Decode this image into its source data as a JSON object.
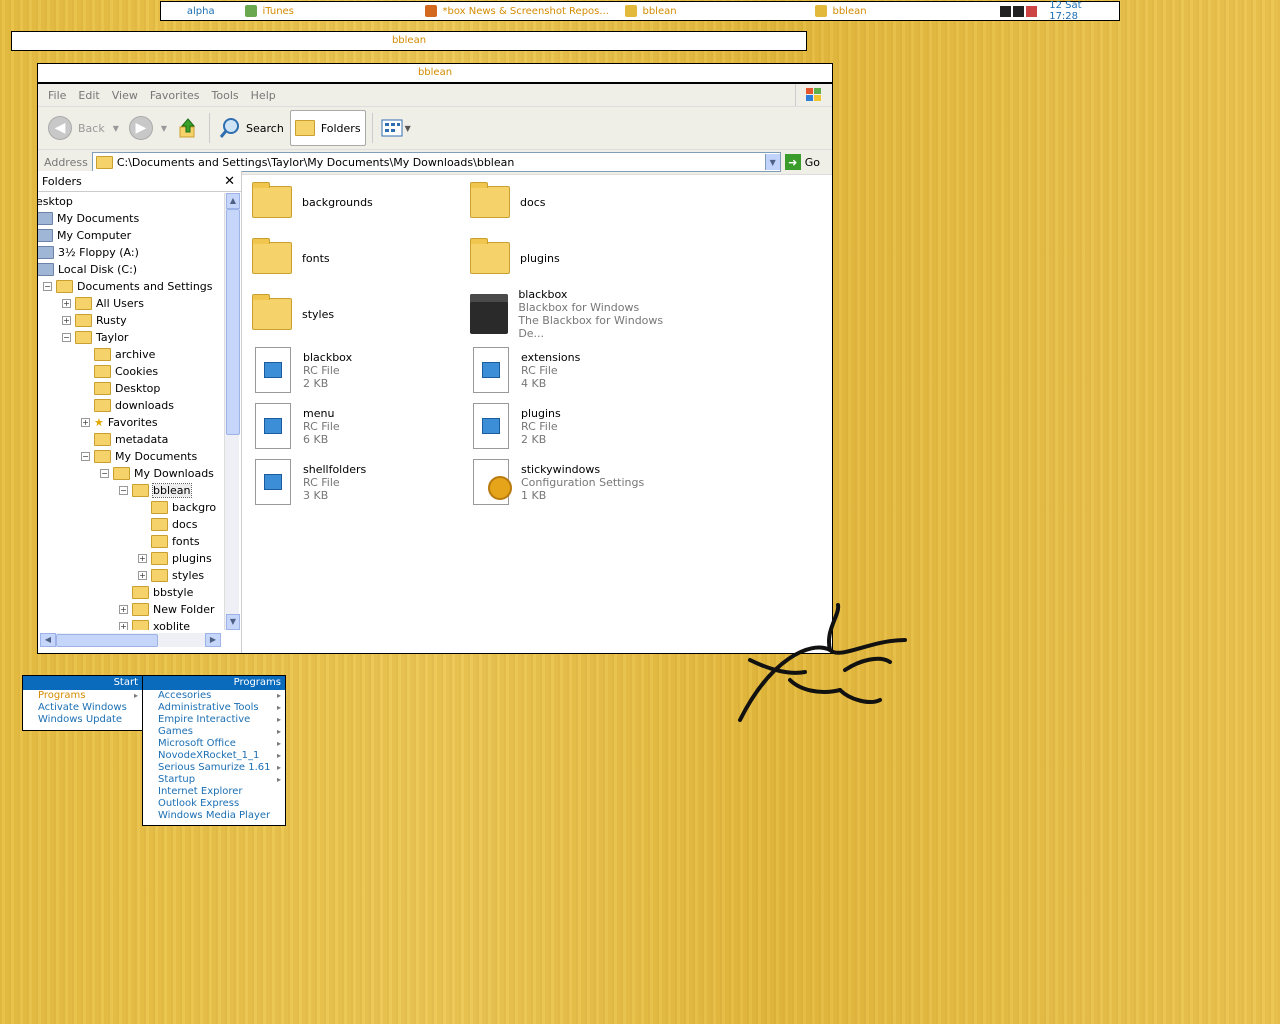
{
  "toolbar": {
    "workspace": "alpha",
    "tasks": [
      {
        "label": "iTunes",
        "icon": "itunes-icon",
        "color": "#6aa84f"
      },
      {
        "label": "*box News & Screenshot Repos...",
        "icon": "firefox-icon",
        "color": "#d2691e"
      },
      {
        "label": "bblean",
        "icon": "explorer-icon",
        "color": "#e2b93b"
      },
      {
        "label": "bblean",
        "icon": "explorer-icon",
        "color": "#e2b93b"
      }
    ],
    "clock": "12 Sat 17:28"
  },
  "slit_title": "bblean",
  "window": {
    "title": "bblean",
    "menu": [
      "File",
      "Edit",
      "View",
      "Favorites",
      "Tools",
      "Help"
    ],
    "toolbar": {
      "back": "Back",
      "search": "Search",
      "folders": "Folders"
    },
    "address": {
      "label": "Address",
      "value": "C:\\Documents and Settings\\Taylor\\My Documents\\My Downloads\\bblean",
      "go": "Go"
    },
    "folders_panel": {
      "title": "Folders",
      "tree": [
        {
          "label": "esktop",
          "indent": 0,
          "expander": "",
          "icon": ""
        },
        {
          "label": "My Documents",
          "indent": 0,
          "expander": "",
          "icon": "my-documents-icon"
        },
        {
          "label": "My Computer",
          "indent": 0,
          "expander": "",
          "icon": "my-computer-icon"
        },
        {
          "label": "3½ Floppy (A:)",
          "indent": 1,
          "expander": "+",
          "icon": "floppy-icon"
        },
        {
          "label": "Local Disk (C:)",
          "indent": 1,
          "expander": "−",
          "icon": "disk-icon"
        },
        {
          "label": "Documents and Settings",
          "indent": 2,
          "expander": "−",
          "icon": "folder"
        },
        {
          "label": "All Users",
          "indent": 3,
          "expander": "+",
          "icon": "folder"
        },
        {
          "label": "Rusty",
          "indent": 3,
          "expander": "+",
          "icon": "folder"
        },
        {
          "label": "Taylor",
          "indent": 3,
          "expander": "−",
          "icon": "folder"
        },
        {
          "label": "archive",
          "indent": 4,
          "expander": "",
          "icon": "folder"
        },
        {
          "label": "Cookies",
          "indent": 4,
          "expander": "",
          "icon": "folder"
        },
        {
          "label": "Desktop",
          "indent": 4,
          "expander": "",
          "icon": "folder"
        },
        {
          "label": "downloads",
          "indent": 4,
          "expander": "",
          "icon": "folder"
        },
        {
          "label": "Favorites",
          "indent": 4,
          "expander": "+",
          "icon": "star"
        },
        {
          "label": "metadata",
          "indent": 4,
          "expander": "",
          "icon": "folder"
        },
        {
          "label": "My Documents",
          "indent": 4,
          "expander": "−",
          "icon": "folder"
        },
        {
          "label": "My Downloads",
          "indent": 5,
          "expander": "−",
          "icon": "folder"
        },
        {
          "label": "bblean",
          "indent": 6,
          "expander": "−",
          "icon": "folder",
          "selected": true
        },
        {
          "label": "backgro",
          "indent": 7,
          "expander": "",
          "icon": "folder"
        },
        {
          "label": "docs",
          "indent": 7,
          "expander": "",
          "icon": "folder"
        },
        {
          "label": "fonts",
          "indent": 7,
          "expander": "",
          "icon": "folder"
        },
        {
          "label": "plugins",
          "indent": 7,
          "expander": "+",
          "icon": "folder"
        },
        {
          "label": "styles",
          "indent": 7,
          "expander": "+",
          "icon": "folder"
        },
        {
          "label": "bbstyle",
          "indent": 6,
          "expander": "",
          "icon": "folder"
        },
        {
          "label": "New Folder",
          "indent": 6,
          "expander": "+",
          "icon": "folder"
        },
        {
          "label": "xoblite",
          "indent": 6,
          "expander": "+",
          "icon": "folder"
        }
      ]
    },
    "files": [
      {
        "name": "backgrounds",
        "type": "folder",
        "sub1": "",
        "sub2": ""
      },
      {
        "name": "docs",
        "type": "folder",
        "sub1": "",
        "sub2": ""
      },
      {
        "name": "fonts",
        "type": "folder",
        "sub1": "",
        "sub2": ""
      },
      {
        "name": "plugins",
        "type": "folder",
        "sub1": "",
        "sub2": ""
      },
      {
        "name": "styles",
        "type": "folder",
        "sub1": "",
        "sub2": ""
      },
      {
        "name": "blackbox",
        "type": "exe",
        "sub1": "Blackbox for Windows",
        "sub2": "The Blackbox for Windows De..."
      },
      {
        "name": "blackbox",
        "type": "rc",
        "sub1": "RC File",
        "sub2": "2 KB"
      },
      {
        "name": "extensions",
        "type": "rc",
        "sub1": "RC File",
        "sub2": "4 KB"
      },
      {
        "name": "menu",
        "type": "rc",
        "sub1": "RC File",
        "sub2": "6 KB"
      },
      {
        "name": "plugins",
        "type": "rc",
        "sub1": "RC File",
        "sub2": "2 KB"
      },
      {
        "name": "shellfolders",
        "type": "rc",
        "sub1": "RC File",
        "sub2": "3 KB"
      },
      {
        "name": "stickywindows",
        "type": "cfg",
        "sub1": "Configuration Settings",
        "sub2": "1 KB"
      }
    ]
  },
  "start_menu": {
    "title": "Start",
    "items": [
      {
        "label": "Programs",
        "submenu": true,
        "active": true
      },
      {
        "label": "Activate Windows",
        "submenu": false,
        "active": false
      },
      {
        "label": "Windows Update",
        "submenu": false,
        "active": false
      }
    ]
  },
  "programs_menu": {
    "title": "Programs",
    "items": [
      {
        "label": "Accesories",
        "submenu": true
      },
      {
        "label": "Administrative Tools",
        "submenu": true
      },
      {
        "label": "Empire Interactive",
        "submenu": true
      },
      {
        "label": "Games",
        "submenu": true
      },
      {
        "label": "Microsoft Office",
        "submenu": true
      },
      {
        "label": "NovodeXRocket_1_1",
        "submenu": true
      },
      {
        "label": "Serious Samurize 1.61",
        "submenu": true
      },
      {
        "label": "Startup",
        "submenu": true
      },
      {
        "label": "Internet Explorer",
        "submenu": false
      },
      {
        "label": "Outlook Express",
        "submenu": false
      },
      {
        "label": "Windows Media Player",
        "submenu": false
      }
    ]
  },
  "colors": {
    "accent_orange": "#d38b00",
    "accent_blue": "#1b6fb3",
    "menu_head": "#0a6bbd",
    "wallpaper": "#e8c14a"
  }
}
